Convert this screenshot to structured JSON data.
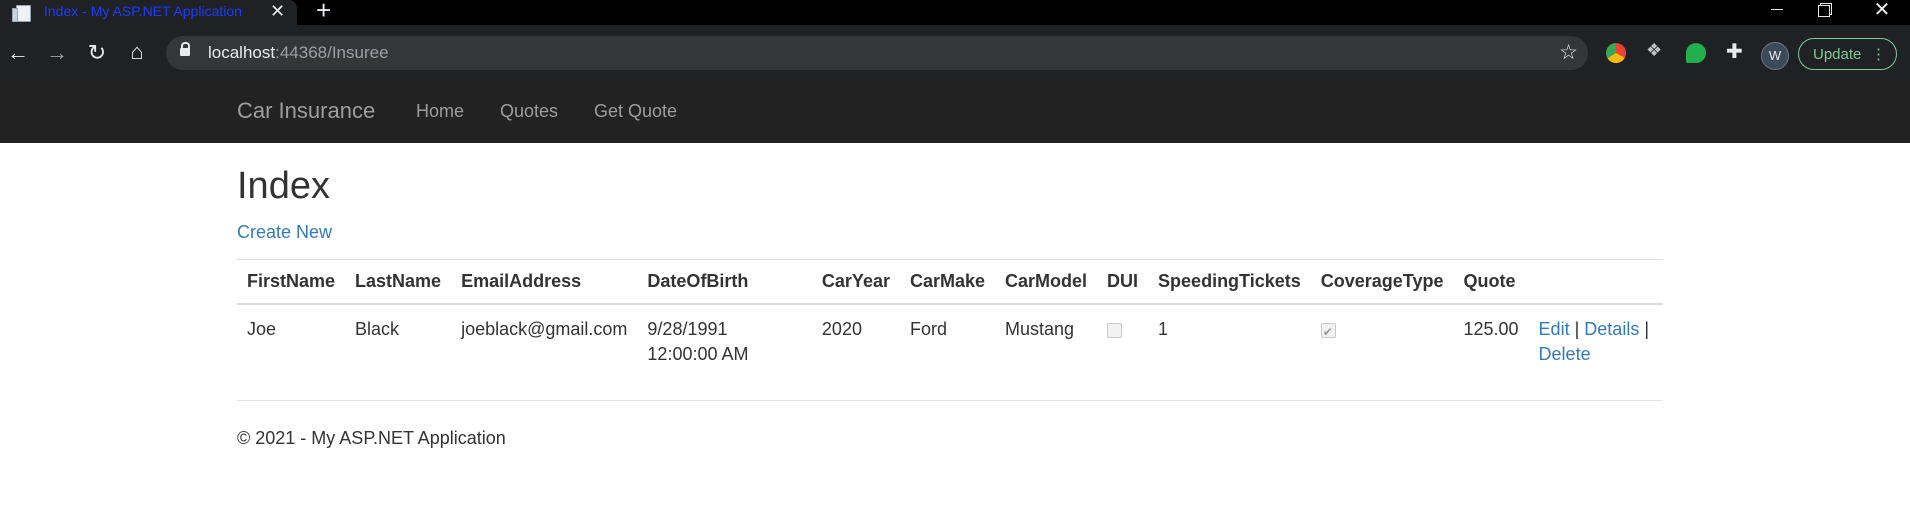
{
  "browser": {
    "tab_title": "Index - My ASP.NET Application",
    "new_tab_glyph": "+",
    "url_host": "localhost",
    "url_rest": ":44368/Insuree",
    "avatar_letter": "W",
    "update_label": "Update"
  },
  "navbar": {
    "brand": "Car Insurance",
    "links": [
      "Home",
      "Quotes",
      "Get Quote"
    ]
  },
  "page": {
    "title": "Index",
    "create_new": "Create New"
  },
  "table": {
    "headers": [
      "FirstName",
      "LastName",
      "EmailAddress",
      "DateOfBirth",
      "CarYear",
      "CarMake",
      "CarModel",
      "DUI",
      "SpeedingTickets",
      "CoverageType",
      "Quote"
    ],
    "rows": [
      {
        "first_name": "Joe",
        "last_name": "Black",
        "email": "joeblack@gmail.com",
        "dob": "9/28/1991 12:00:00 AM",
        "car_year": "2020",
        "car_make": "Ford",
        "car_model": "Mustang",
        "dui": false,
        "speeding_tickets": "1",
        "coverage_type": true,
        "quote": "125.00",
        "actions": {
          "edit": "Edit",
          "details": "Details",
          "delete": "Delete",
          "separator": "|"
        }
      }
    ]
  },
  "footer": {
    "text": "© 2021 - My ASP.NET Application"
  },
  "icons": {
    "favicon": "page-icon",
    "close": "close-icon",
    "back": "back-arrow-icon",
    "forward": "forward-arrow-icon",
    "reload": "reload-icon",
    "home": "home-icon",
    "lock": "lock-icon",
    "star": "star-icon",
    "extensions": "puzzle-icon",
    "menu": "kebab-menu-icon"
  },
  "colors": {
    "link": "#337ab7",
    "navbar_bg": "#222222",
    "update_accent": "#81c995"
  }
}
